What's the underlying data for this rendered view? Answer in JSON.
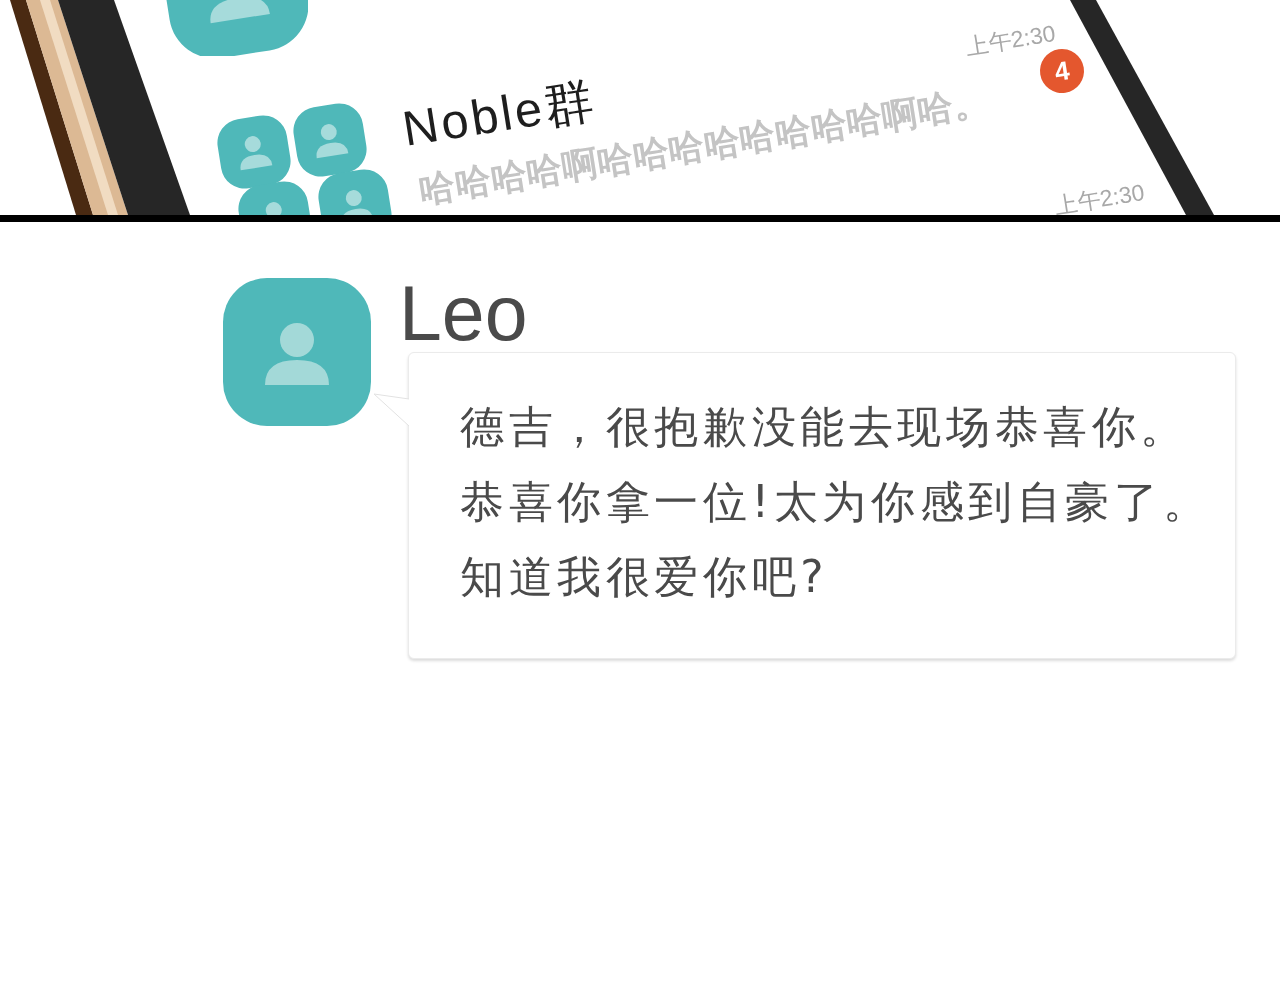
{
  "phone_screen": {
    "chat_rows": [
      {
        "kind": "single"
      },
      {
        "kind": "group",
        "name": "Noble群",
        "preview": "哈哈哈哈啊哈哈哈哈哈哈哈哈啊哈。",
        "time": "上午2:30",
        "unread": "4"
      },
      {
        "time": "上午2:30"
      }
    ]
  },
  "chat": {
    "sender": "Leo",
    "message_lines": [
      "德吉，很抱歉没能去现场恭喜你。",
      "恭喜你拿一位!太为你感到自豪了。",
      "知道我很爱你吧?"
    ]
  }
}
